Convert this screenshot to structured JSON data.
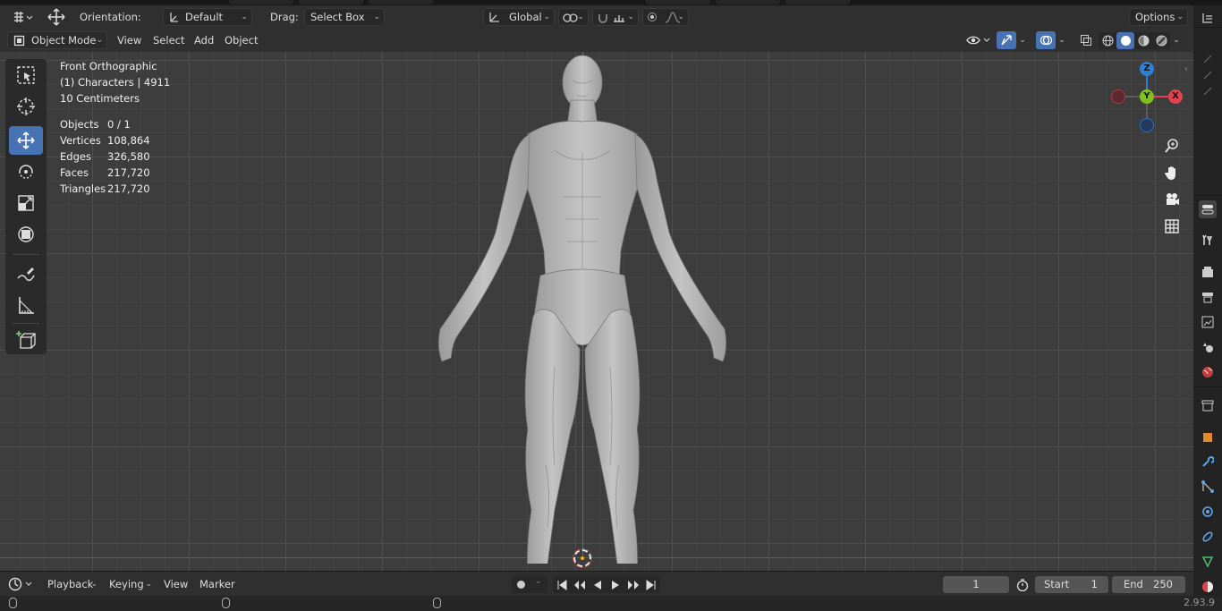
{
  "toolheader": {
    "orientation_label": "Orientation:",
    "orientation_value": "Default",
    "drag_label": "Drag:",
    "drag_value": "Select Box",
    "transform_orientation": "Global",
    "options_label": "Options"
  },
  "viewheader": {
    "mode": "Object Mode",
    "menus": [
      "View",
      "Select",
      "Add",
      "Object"
    ]
  },
  "viewport": {
    "view_name": "Front Orthographic",
    "collection_info": "(1) Characters | 4911",
    "scale": "10 Centimeters",
    "stats": [
      {
        "label": "Objects",
        "value": "0 / 1"
      },
      {
        "label": "Vertices",
        "value": "108,864"
      },
      {
        "label": "Edges",
        "value": "326,580"
      },
      {
        "label": "Faces",
        "value": "217,720"
      },
      {
        "label": "Triangles",
        "value": "217,720"
      }
    ],
    "gizmo": {
      "z": "Z",
      "y": "Y",
      "x": "X"
    }
  },
  "timeline": {
    "menus": [
      "Playback",
      "Keying",
      "View",
      "Marker"
    ],
    "current_frame": "1",
    "start_label": "Start",
    "start_value": "1",
    "end_label": "End",
    "end_value": "250"
  },
  "statusbar": {
    "version": "2.93.9"
  },
  "colors": {
    "accent": "#4772b3",
    "axis_x": "#e0434d",
    "axis_y": "#7fc11c",
    "axis_z": "#2f7fd6",
    "floor_x_line": "#b03a44",
    "z_axis_line": "#3b6fc4"
  },
  "icons": {
    "tools": [
      "select-box-icon",
      "cursor-icon",
      "move-icon",
      "rotate-icon",
      "scale-icon",
      "transform-icon",
      "annotate-icon",
      "measure-icon",
      "add-cube-icon"
    ],
    "nav": [
      "zoom-icon",
      "pan-hand-icon",
      "camera-icon",
      "grid-icon"
    ],
    "properties": [
      "tool-icon",
      "render-icon",
      "output-icon",
      "view-layer-icon",
      "scene-icon",
      "world-icon",
      "collection-icon",
      "object-icon",
      "modifier-icon",
      "particles-icon",
      "physics-icon",
      "constraints-icon",
      "data-icon",
      "material-icon"
    ]
  }
}
